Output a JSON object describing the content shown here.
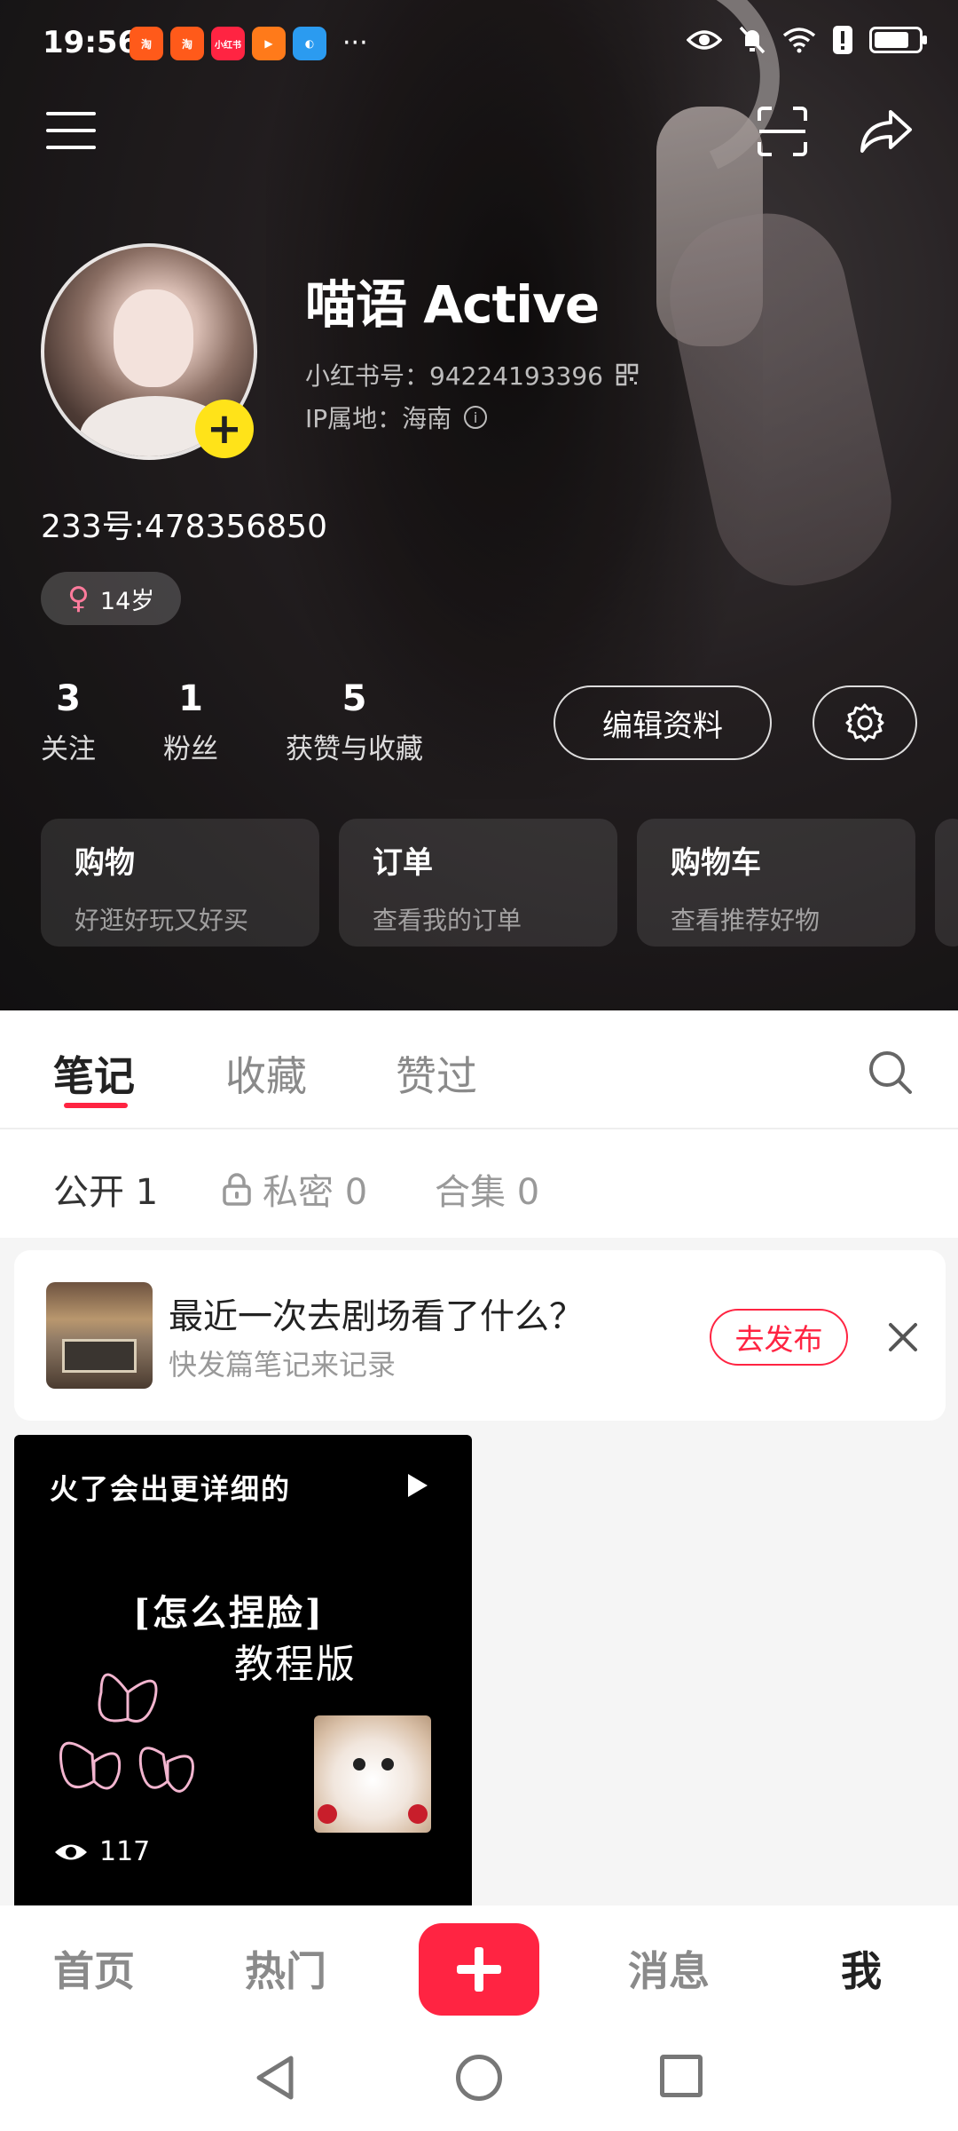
{
  "status_bar": {
    "time": "19:56",
    "app_icons": [
      {
        "name": "taobao-icon",
        "label": "淘",
        "color": "#ff5a1a"
      },
      {
        "name": "taobao-icon-2",
        "label": "淘",
        "color": "#ff5a1a"
      },
      {
        "name": "xiaohongshu-icon",
        "label": "小红书",
        "color": "#ff2442"
      },
      {
        "name": "player-icon",
        "label": "▶",
        "color": "#ff7a1a"
      },
      {
        "name": "browser-icon",
        "label": "◐",
        "color": "#2b9bf0"
      }
    ],
    "more": "···",
    "battery_level": 0.8
  },
  "profile": {
    "nickname": "喵语 Active",
    "redbook_id": "小红书号：94224193396",
    "ip_location": "IP属地：海南",
    "bio": "233号:478356850",
    "gender_symbol": "♀",
    "age": "14岁",
    "avatar_add": "+"
  },
  "stats": [
    {
      "num": "3",
      "label": "关注"
    },
    {
      "num": "1",
      "label": "粉丝"
    },
    {
      "num": "5",
      "label": "获赞与收藏"
    }
  ],
  "actions": {
    "edit_profile": "编辑资料"
  },
  "cards": [
    {
      "title": "购物",
      "subtitle": "好逛好玩又好买"
    },
    {
      "title": "订单",
      "subtitle": "查看我的订单"
    },
    {
      "title": "购物车",
      "subtitle": "查看推荐好物"
    }
  ],
  "tabs": [
    {
      "label": "笔记",
      "active": true
    },
    {
      "label": "收藏",
      "active": false
    },
    {
      "label": "赞过",
      "active": false
    }
  ],
  "subtabs": [
    {
      "label": "公开 1",
      "active": true
    },
    {
      "label": "私密 0",
      "active": false
    },
    {
      "label": "合集 0",
      "active": false
    }
  ],
  "prompt": {
    "title": "最近一次去剧场看了什么？",
    "subtitle": "快发篇笔记来记录",
    "button": "去发布"
  },
  "note": {
    "top_text": "火了会出更详细的",
    "line1": "[怎么捏脸]",
    "line2": "教程版",
    "views": "117"
  },
  "bottom_nav": [
    {
      "label": "首页",
      "active": false
    },
    {
      "label": "热门",
      "active": false
    },
    {
      "label": "消息",
      "active": false
    },
    {
      "label": "我",
      "active": true
    }
  ],
  "colors": {
    "accent": "#ff2442",
    "avatar_badge": "#ffe319"
  }
}
